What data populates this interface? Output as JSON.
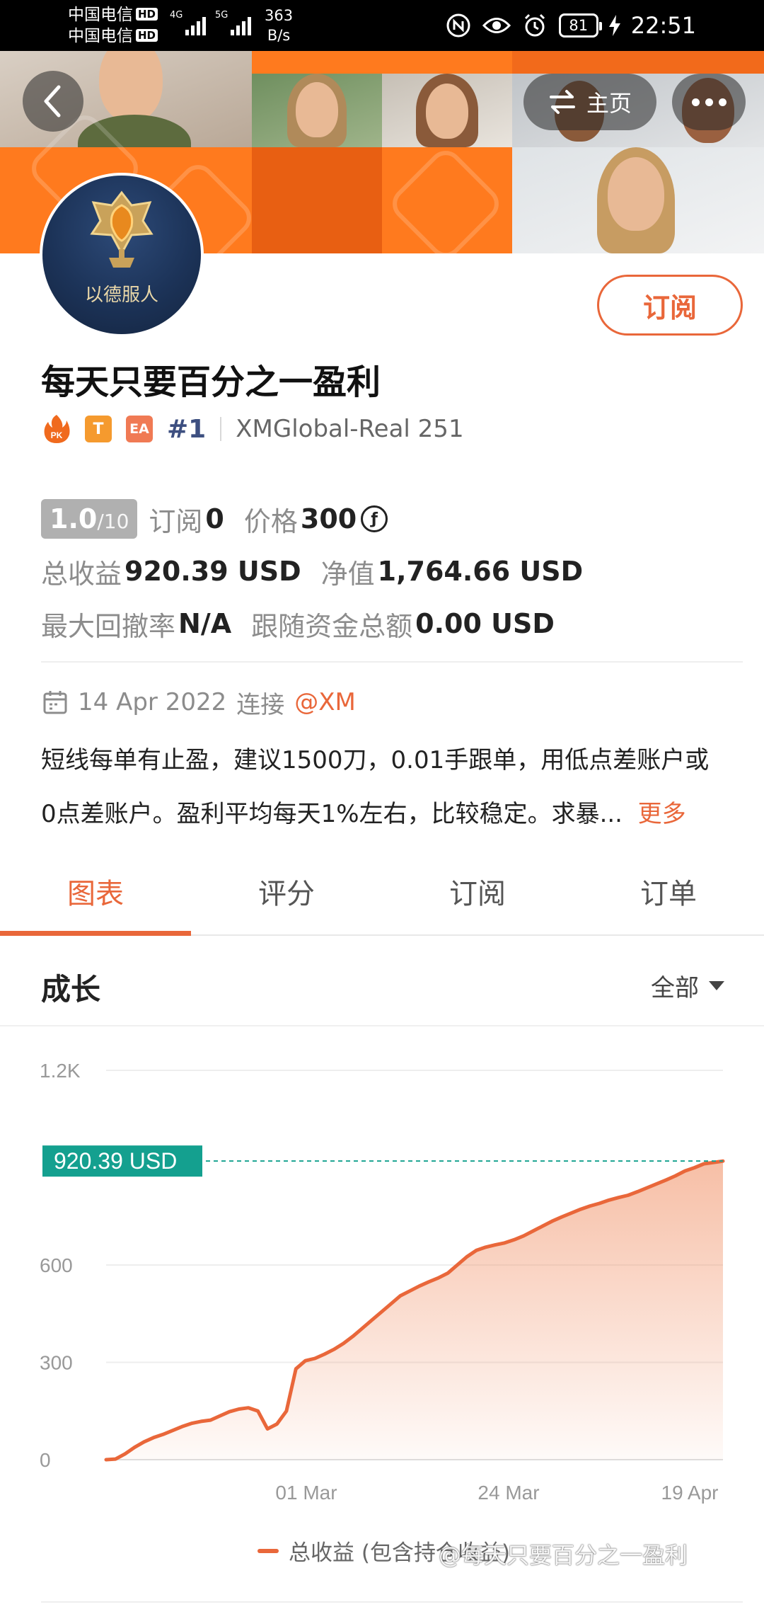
{
  "status_bar": {
    "carrier1": "中国电信",
    "carrier2": "中国电信",
    "hd": "HD",
    "net1": "4G",
    "net2": "5G",
    "speed_value": "363",
    "speed_unit": "B/s",
    "battery": "81",
    "time": "22:51"
  },
  "header": {
    "home_label": "主页"
  },
  "profile": {
    "avatar_text": "以德服人",
    "subscribe_label": "订阅",
    "title": "每天只要百分之一盈利",
    "badge_pk": "PK",
    "badge_t": "T",
    "badge_ea": "EA",
    "rank": "#1",
    "account": "XMGlobal-Real 251"
  },
  "stats": {
    "score": "1.0",
    "score_max": "/10",
    "subs_label": "订阅",
    "subs_value": "0",
    "price_label": "价格",
    "price_value": "300",
    "coin_symbol": "ƒ",
    "profit_label": "总收益",
    "profit_value": "920.39 USD",
    "equity_label": "净值",
    "equity_value": "1,764.66 USD",
    "drawdown_label": "最大回撤率",
    "drawdown_value": "N/A",
    "follow_label": "跟随资金总额",
    "follow_value": "0.00 USD"
  },
  "meta": {
    "date": "14 Apr 2022",
    "connect_label": "连接",
    "broker": "@XM"
  },
  "description": {
    "line1": "短线每单有止盈，建议1500刀，0.01手跟单，用低点差账户或",
    "line2": "0点差账户。盈利平均每天1%左右，比较稳定。求暴...",
    "more": "更多"
  },
  "tabs": [
    {
      "label": "图表"
    },
    {
      "label": "评分"
    },
    {
      "label": "订阅"
    },
    {
      "label": "订单"
    }
  ],
  "section": {
    "title": "成长",
    "filter": "全部"
  },
  "chart_data": {
    "type": "area",
    "color": "#e9673a",
    "yticks": [
      "1.2K",
      "600",
      "300",
      "0"
    ],
    "ytick_values": [
      1200,
      600,
      300,
      0
    ],
    "xticks": [
      "01 Mar",
      "24 Mar",
      "19 Apr"
    ],
    "ylim": [
      0,
      1200
    ],
    "current_label": "920.39 USD",
    "current_value": 920.39,
    "legend": "总收益 (包含持仓收益)",
    "series": [
      {
        "name": "总收益 (包含持仓收益)",
        "values": [
          0,
          2,
          18,
          38,
          55,
          68,
          78,
          90,
          102,
          112,
          118,
          122,
          135,
          148,
          156,
          160,
          150,
          95,
          110,
          150,
          280,
          305,
          312,
          325,
          340,
          358,
          380,
          405,
          430,
          455,
          480,
          505,
          520,
          535,
          548,
          560,
          575,
          600,
          625,
          645,
          655,
          662,
          668,
          678,
          690,
          705,
          720,
          735,
          748,
          760,
          772,
          782,
          790,
          800,
          808,
          815,
          826,
          838,
          850,
          862,
          875,
          890,
          900,
          912,
          916,
          920.39
        ]
      }
    ]
  },
  "watermark": "@每天只要百分之一盈利"
}
